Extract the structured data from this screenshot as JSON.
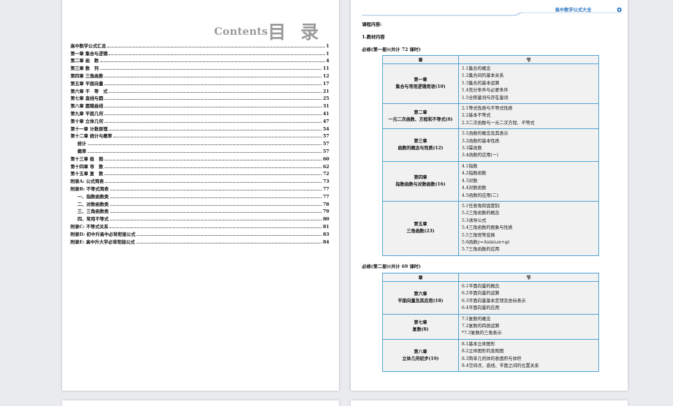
{
  "toc": {
    "header_en": "Contents",
    "header_zh": "目 录",
    "entries": [
      {
        "title": "高中数学公式汇总",
        "page": "1"
      },
      {
        "title": "第一章 集合与逻辑",
        "page": "1"
      },
      {
        "title": "第二章 函　数",
        "page": "4"
      },
      {
        "title": "第三章 数　列",
        "page": "11"
      },
      {
        "title": "第四章 三角函数",
        "page": "12"
      },
      {
        "title": "第五章 平面向量",
        "page": "17"
      },
      {
        "title": "第六章 不　等　式",
        "page": "21"
      },
      {
        "title": "第七章 直线与圆",
        "page": "25"
      },
      {
        "title": "第八章 圆锥曲线",
        "page": "31"
      },
      {
        "title": "第九章 平面几何",
        "page": "41"
      },
      {
        "title": "第十章 立体几何",
        "page": "47"
      },
      {
        "title": "第十一章 计数原理",
        "page": "54"
      },
      {
        "title": "第十二章 统计与概率",
        "page": "57"
      },
      {
        "title": "统计",
        "page": "57",
        "indent": true
      },
      {
        "title": "概率",
        "page": "57",
        "indent": true
      },
      {
        "title": "第十三章 极　限",
        "page": "60"
      },
      {
        "title": "第十四章 导　数",
        "page": "62"
      },
      {
        "title": "第十五章 复　数",
        "page": "72"
      },
      {
        "title": "附录A: 公式简表",
        "page": "73"
      },
      {
        "title": "附录B: 不等式简表",
        "page": "77"
      },
      {
        "title": "一、指数函数类",
        "page": "77",
        "indent": true
      },
      {
        "title": "二、对数函数类",
        "page": "78",
        "indent": true
      },
      {
        "title": "三、三角函数类",
        "page": "79",
        "indent": true
      },
      {
        "title": "四、常用不等式",
        "page": "80",
        "indent": true
      },
      {
        "title": "附录C: 不等式关系",
        "page": "81"
      },
      {
        "title": "附录D: 初中升高中必背衔接公式",
        "page": "83"
      },
      {
        "title": "附录E: 高中升大学必背衔接公式",
        "page": "84"
      }
    ]
  },
  "right": {
    "header_title": "高中数学公式大全",
    "course_label": "课程内容:",
    "section_label": "1.教材内容",
    "book1_label": "必修(第一册)(共计 72 课时)",
    "book2_label": "必修(第二册)(共计 69 课时)",
    "col_chapter": "章",
    "col_section": "节",
    "book1_rows": [
      {
        "ch1": "第一章",
        "ch2": "集合与常用逻辑用语(10)",
        "secs": [
          "1.1集合的概念",
          "1.2集合间的基本关系",
          "1.3集合的基本运算",
          "1.4充分条件与必要条件",
          "1.5全称量词与存在量词"
        ]
      },
      {
        "ch1": "第二章",
        "ch2": "一元二次函数、方程和不等式(8)",
        "secs": [
          "2.1等式性质与不等式性质",
          "2.2基本不等式",
          "2.3二次函数与一元二次方程、不等式"
        ]
      },
      {
        "ch1": "第三章",
        "ch2": "函数的概念与性质(12)",
        "secs": [
          "3.1函数的概念及其表示",
          "3.2函数的基本性质",
          "3.3幂函数",
          "3.4函数的应用(一)"
        ]
      },
      {
        "ch1": "第四章",
        "ch2": "指数函数与对数函数(16)",
        "secs": [
          "4.1指数",
          "4.2指数函数",
          "4.3对数",
          "4.4对数函数",
          "4.5函数的应用(二)"
        ]
      },
      {
        "ch1": "第五章",
        "ch2": "三角函数(23)",
        "secs": [
          "5.1任意角和弧度制",
          "5.2三角函数的概念",
          "5.3诱导公式",
          "5.4三角函数的图象与性质",
          "5.5三角恒等变换",
          "5.6函数y=Asin(ωx+φ)",
          "5.7三角函数的应用"
        ]
      }
    ],
    "book2_rows": [
      {
        "ch1": "第六章",
        "ch2": "平面向量及其应用(18)",
        "secs": [
          "6.1平面向量的概念",
          "6.2平面向量的运算",
          "6.3平面向量基本定理及坐标表示",
          "6.4平面向量的应用"
        ]
      },
      {
        "ch1": "第七章",
        "ch2": "复数(8)",
        "secs": [
          "7.1复数的概念",
          "7.2复数的四则运算",
          "*7.3复数的三角表示"
        ]
      },
      {
        "ch1": "第八章",
        "ch2": "立体几何初步(19)",
        "secs": [
          "8.1基本立体图形",
          "8.2立体图形的直观图",
          "8.3简单几何体的表面积与体积",
          "8.4空间点、直线、平面之间的位置关系"
        ]
      }
    ]
  },
  "colors": {
    "accent": "#2b77c4",
    "table_border": "#4aa0d3",
    "contents_gray": "#9b9b9b"
  }
}
